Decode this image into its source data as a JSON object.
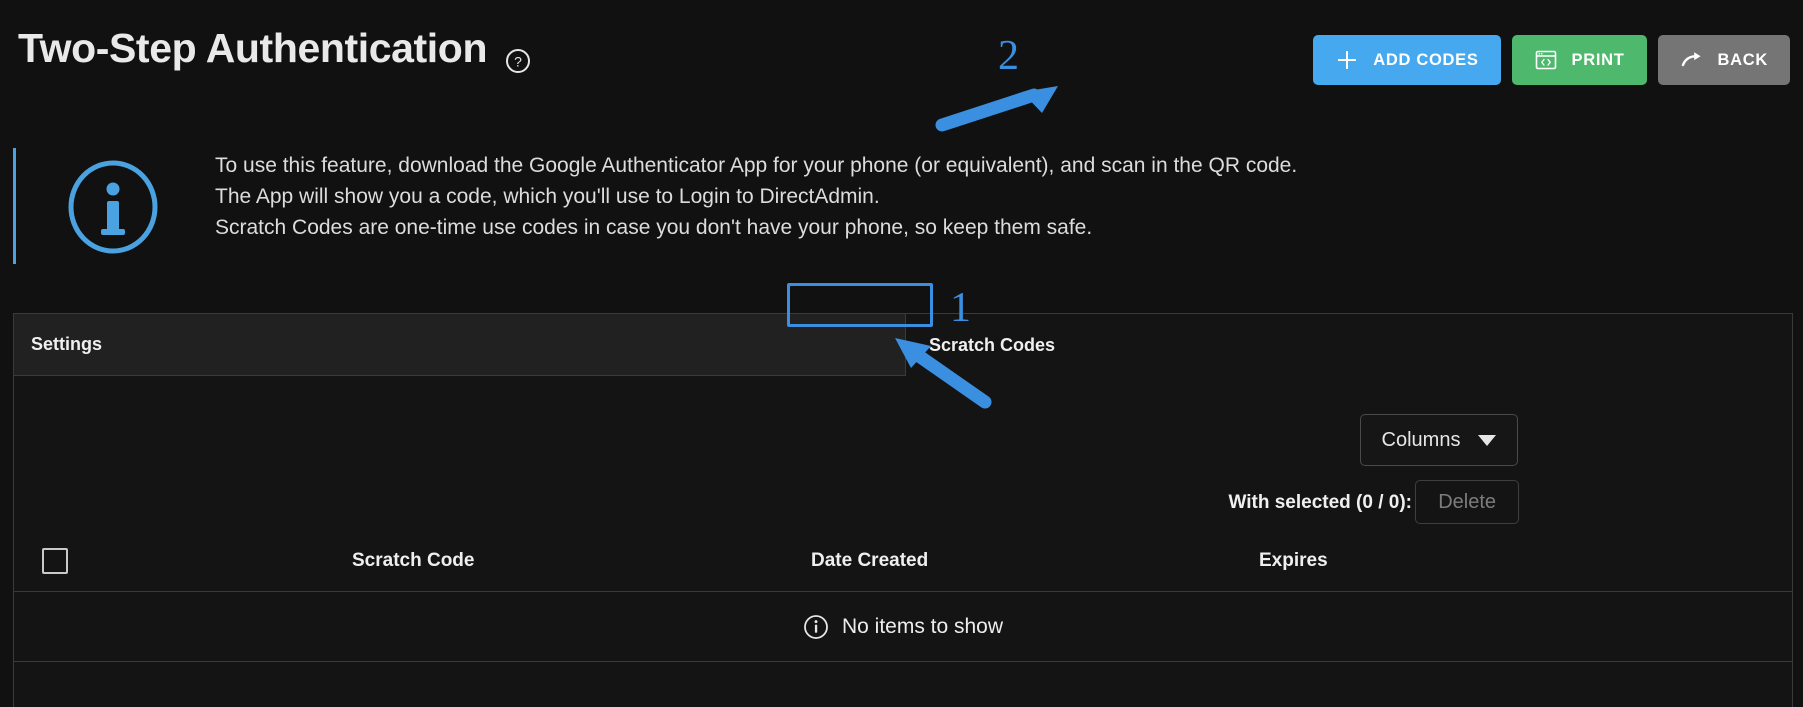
{
  "header": {
    "title": "Two-Step Authentication",
    "help_icon": "question-circle-icon",
    "buttons": [
      {
        "label": "ADD CODES",
        "icon": "plus-icon",
        "color": "#46a9f0"
      },
      {
        "label": "PRINT",
        "icon": "code-window-icon",
        "color": "#4eb96c"
      },
      {
        "label": "BACK",
        "icon": "arrow-forward-icon",
        "color": "#757575"
      }
    ]
  },
  "annotations": {
    "color": "#3b8fe0",
    "markers": [
      {
        "number": "1",
        "points_to": "scratch-codes-tab"
      },
      {
        "number": "2",
        "points_to": "add-codes-button"
      }
    ]
  },
  "info": {
    "icon": "info-circle-icon",
    "accent": "#4aa3e0",
    "lines": [
      "To use this feature, download the Google Authenticator App for your phone (or equivalent), and scan in the QR code.",
      "The App will show you a code, which you'll use to Login to DirectAdmin.",
      "Scratch Codes are one-time use codes in case you don't have your phone, so keep them safe."
    ]
  },
  "panel": {
    "tabs": [
      {
        "label": "Settings",
        "active": false
      },
      {
        "label": "Scratch Codes",
        "active": true
      }
    ],
    "toolbar": {
      "columns_label": "Columns",
      "columns_icon": "chevron-down-icon",
      "with_selected_label": "With selected (0 / 0):",
      "delete_label": "Delete"
    },
    "table": {
      "columns": [
        "Scratch Code",
        "Date Created",
        "Expires"
      ],
      "rows": [],
      "empty_message": "No items to show",
      "empty_icon": "info-circle-icon"
    }
  }
}
